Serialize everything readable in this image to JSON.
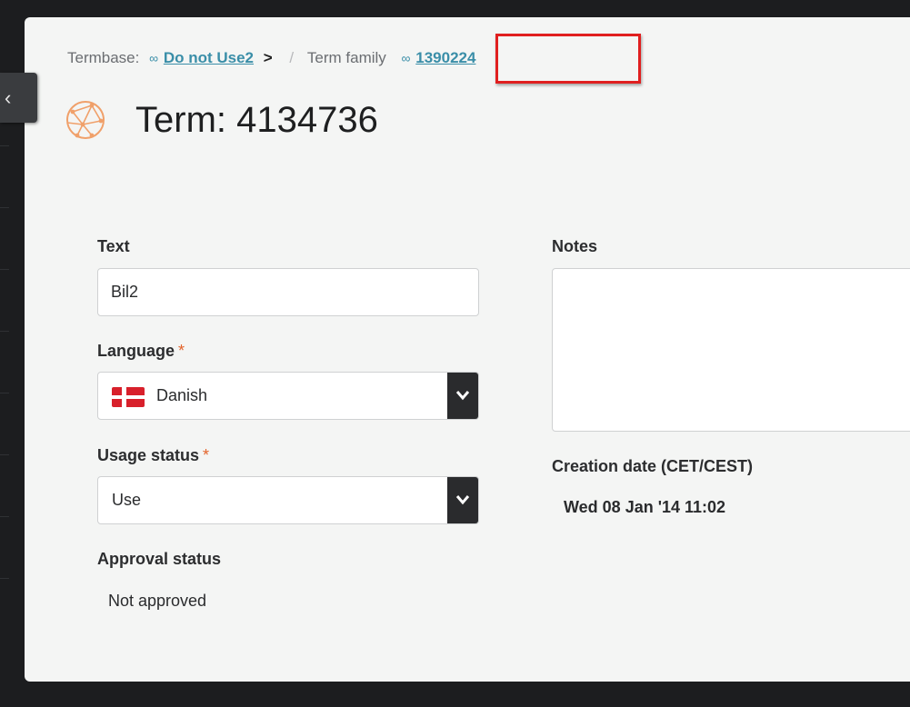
{
  "breadcrumb": {
    "termbase_label": "Termbase:",
    "termbase_link_icon": "link-icon",
    "termbase_link": "Do not Use2",
    "arrow": ">",
    "separator": "/",
    "family_label": "Term family",
    "family_link_icon": "link-icon",
    "family_link": "1390224",
    "highlight_color": "#e01f1f"
  },
  "header": {
    "icon": "term-globe-icon",
    "title": "Term: 4134736",
    "icon_color": "#f0a06a"
  },
  "form": {
    "text_label": "Text",
    "text_value": "Bil2",
    "language_label": "Language",
    "required_mark": "*",
    "language_value": "Danish",
    "language_flag": "denmark-flag",
    "usage_label": "Usage status",
    "usage_value": "Use",
    "approval_label": "Approval status",
    "approval_value": "Not approved",
    "notes_label": "Notes",
    "notes_value": "",
    "creation_label": "Creation date (CET/CEST)",
    "creation_value": "Wed 08 Jan '14 11:02"
  },
  "sidebar": {
    "collapse_icon": "chevron-left-icon"
  }
}
